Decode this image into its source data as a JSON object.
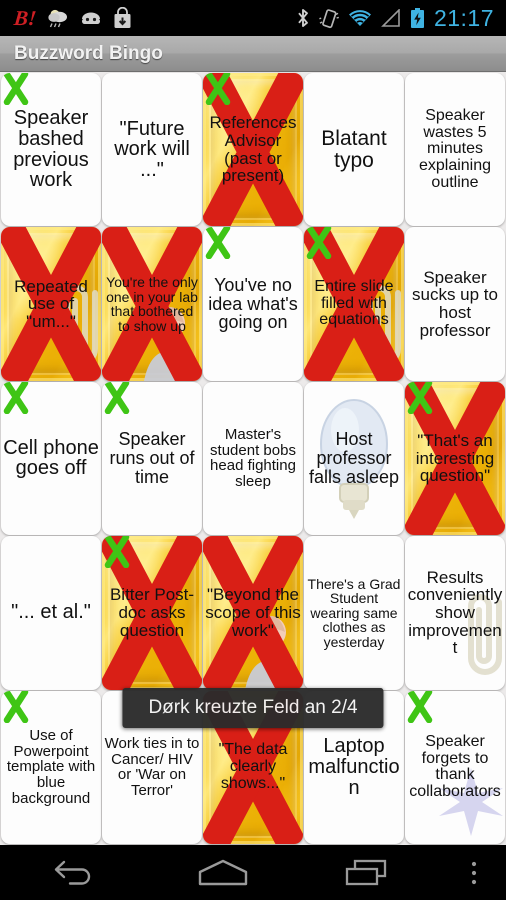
{
  "status_bar": {
    "time": "21:17",
    "left_icons": [
      "bang-notification-icon",
      "weather-cloud-icon",
      "android-head-icon",
      "download-bag-icon"
    ],
    "right_icons": [
      "bluetooth-icon",
      "vibrate-icon",
      "wifi-icon",
      "cell-signal-icon",
      "battery-charging-icon"
    ],
    "bang_label": "B!"
  },
  "action_bar": {
    "title": "Buzzword Bingo"
  },
  "toast": {
    "message": "Dørk kreuzte Feld an 2/4"
  },
  "nav_bar": {
    "buttons": [
      "back-button",
      "home-button",
      "recent-apps-button",
      "overflow-menu-button"
    ]
  },
  "colors": {
    "gold": "#f2b705",
    "red_cross": "#d91f16",
    "green_check": "#3fc515",
    "accent_clock": "#3fb3e2",
    "action_bar": "#a9a9a9"
  },
  "board": {
    "rows": 5,
    "cols": 5,
    "cells": [
      {
        "text": "Speaker bashed previous work",
        "marked": false,
        "green": true,
        "size": "s20",
        "art": "none"
      },
      {
        "text": "\"Future work will ...\"",
        "marked": false,
        "green": false,
        "size": "s20",
        "art": "none"
      },
      {
        "text": "References Advisor (past or present)",
        "marked": true,
        "green": true,
        "size": "s17",
        "art": "none"
      },
      {
        "text": "Blatant typo",
        "marked": false,
        "green": false,
        "size": "s21",
        "art": "none"
      },
      {
        "text": "Speaker wastes 5 minutes explaining outline",
        "marked": false,
        "green": false,
        "size": "s16",
        "art": "none"
      },
      {
        "text": "Repeated use of \"um...\"",
        "marked": true,
        "green": false,
        "size": "s17",
        "art": "clip"
      },
      {
        "text": "You're the only one in your lab that bothered to show up",
        "marked": true,
        "green": false,
        "size": "s14",
        "art": "person"
      },
      {
        "text": "You've no idea what's going on",
        "marked": false,
        "green": true,
        "size": "s18",
        "art": "none"
      },
      {
        "text": "Entire slide filled with equations",
        "marked": true,
        "green": true,
        "size": "s16",
        "art": "clip"
      },
      {
        "text": "Speaker sucks up to host professor",
        "marked": false,
        "green": false,
        "size": "s17",
        "art": "none"
      },
      {
        "text": "Cell phone goes off",
        "marked": false,
        "green": true,
        "size": "s20",
        "art": "none"
      },
      {
        "text": "Speaker runs out of time",
        "marked": false,
        "green": true,
        "size": "s18",
        "art": "none"
      },
      {
        "text": "Master's student bobs head fighting sleep",
        "marked": false,
        "green": false,
        "size": "s15",
        "art": "none"
      },
      {
        "text": "Host professor falls asleep",
        "marked": false,
        "green": false,
        "size": "s18",
        "art": "bulb"
      },
      {
        "text": "\"That's an interesting question\"",
        "marked": true,
        "green": true,
        "size": "s17",
        "art": "none"
      },
      {
        "text": "\"... et al.\"",
        "marked": false,
        "green": false,
        "size": "s20",
        "art": "none"
      },
      {
        "text": "Bitter Post-doc asks question",
        "marked": true,
        "green": true,
        "size": "s17",
        "art": "none"
      },
      {
        "text": "\"Beyond the scope of this work\"",
        "marked": true,
        "green": false,
        "size": "s17",
        "art": "person"
      },
      {
        "text": "There's a Grad Student wearing same clothes as yesterday",
        "marked": false,
        "green": false,
        "size": "s14",
        "art": "none"
      },
      {
        "text": "Results conveniently show improvement",
        "marked": false,
        "green": false,
        "size": "s17",
        "art": "clip"
      },
      {
        "text": "Use of Powerpoint template with blue background",
        "marked": false,
        "green": true,
        "size": "s15",
        "art": "none"
      },
      {
        "text": "Work ties in to Cancer/ HIV or 'War on Terror'",
        "marked": false,
        "green": false,
        "size": "s15",
        "art": "none"
      },
      {
        "text": "\"The data clearly shows...\"",
        "marked": true,
        "green": false,
        "size": "s16",
        "art": "none"
      },
      {
        "text": "Laptop malfunction",
        "marked": false,
        "green": false,
        "size": "s20",
        "art": "none"
      },
      {
        "text": "Speaker forgets to thank collaborators",
        "marked": false,
        "green": true,
        "size": "s16",
        "art": "star"
      }
    ]
  }
}
